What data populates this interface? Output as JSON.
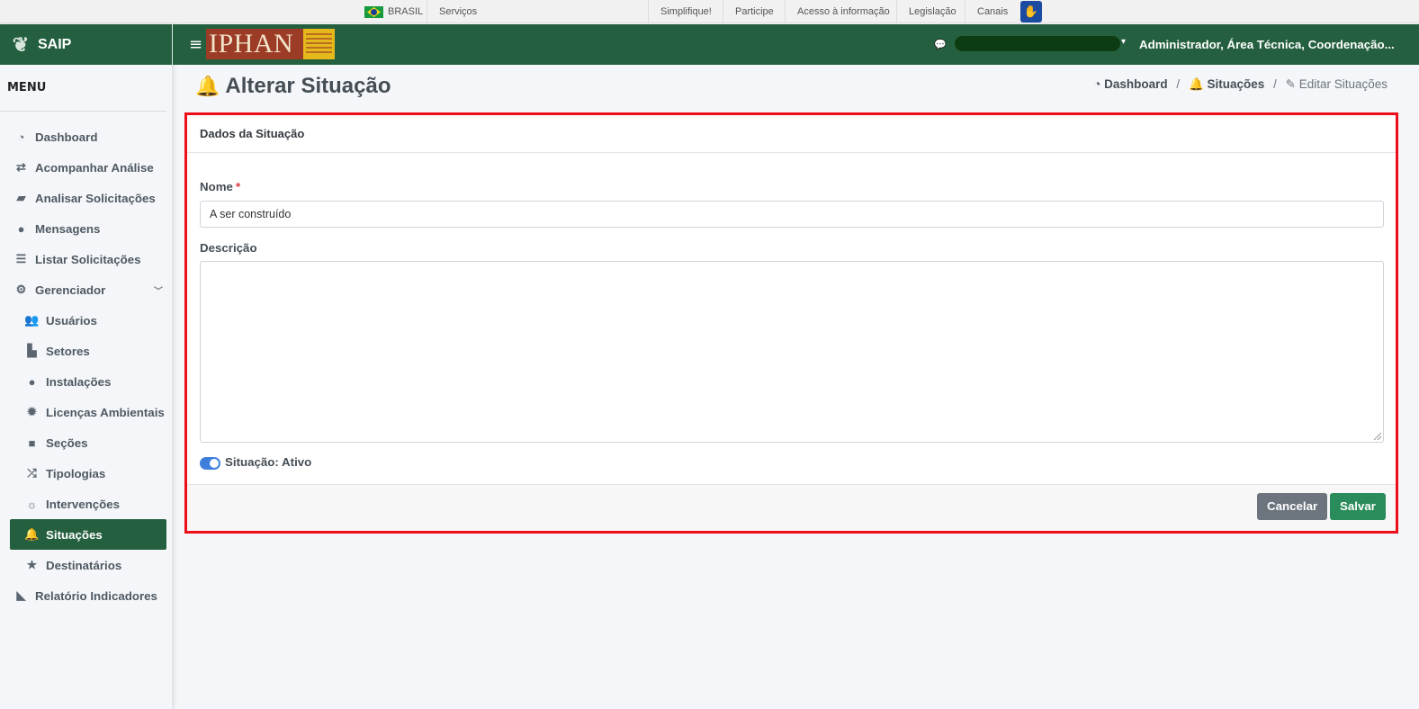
{
  "govbar": {
    "country": "BRASIL",
    "links": [
      "Serviços",
      "Simplifique!",
      "Participe",
      "Acesso à informação",
      "Legislação",
      "Canais"
    ]
  },
  "sidebar": {
    "brand": "SAIP",
    "menu_title": "MENU",
    "items": [
      {
        "label": "Dashboard",
        "icon": "dashboard-icon"
      },
      {
        "label": "Acompanhar Análise",
        "icon": "exchange-icon"
      },
      {
        "label": "Analisar Solicitações",
        "icon": "book-icon"
      },
      {
        "label": "Mensagens",
        "icon": "comments-icon"
      },
      {
        "label": "Listar Solicitações",
        "icon": "list-icon"
      },
      {
        "label": "Gerenciador",
        "icon": "cogs-icon"
      },
      {
        "label": "Usuários",
        "icon": "users-icon"
      },
      {
        "label": "Setores",
        "icon": "industry-icon"
      },
      {
        "label": "Instalações",
        "icon": "circle-icon"
      },
      {
        "label": "Licenças Ambientais",
        "icon": "certificate-icon"
      },
      {
        "label": "Seções",
        "icon": "square-icon"
      },
      {
        "label": "Tipologias",
        "icon": "random-icon"
      },
      {
        "label": "Intervenções",
        "icon": "sun-icon"
      },
      {
        "label": "Situações",
        "icon": "bell-icon"
      },
      {
        "label": "Destinatários",
        "icon": "star-icon"
      },
      {
        "label": "Relatório Indicadores",
        "icon": "chart-area-icon"
      }
    ]
  },
  "header": {
    "logo": "IPHAN",
    "user": "Administrador, Área Técnica, Coordenação..."
  },
  "page": {
    "title": "Alterar Situação",
    "breadcrumb": [
      "Dashboard",
      "Situações",
      "Editar Situações"
    ]
  },
  "form": {
    "card_title": "Dados da Situação",
    "nome_label": "Nome",
    "required_mark": "*",
    "nome_value": "A ser construído",
    "descricao_label": "Descrição",
    "descricao_value": "",
    "situacao_label": "Situação: Ativo",
    "situacao_on": true,
    "cancel_label": "Cancelar",
    "save_label": "Salvar"
  },
  "colors": {
    "brand_green": "#24603f",
    "highlight_red": "#ee0e1a",
    "save_green": "#2a8c5a",
    "cancel_gray": "#6c757d"
  }
}
